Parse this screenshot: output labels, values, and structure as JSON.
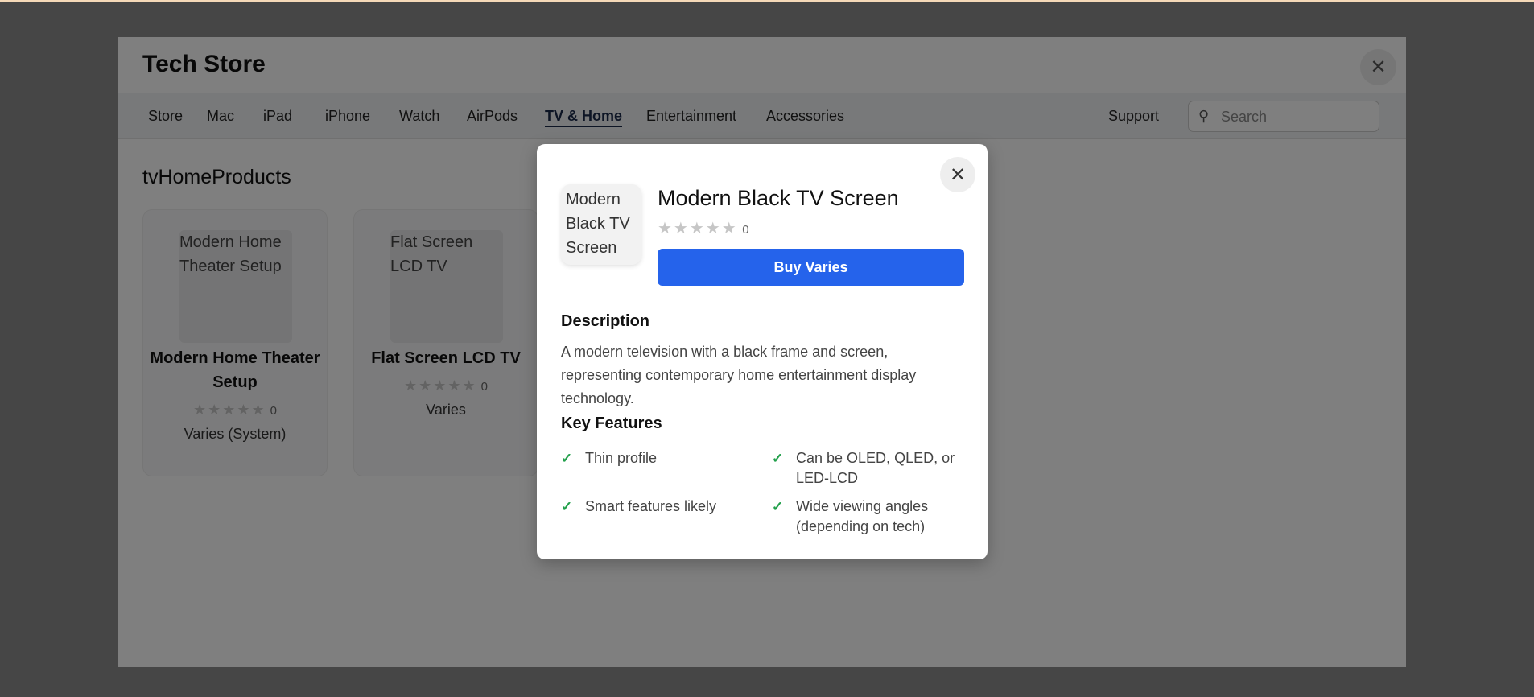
{
  "colors": {
    "accent": "#2563eb",
    "backdrop": "#464646",
    "check": "#22a04b",
    "star_empty": "#c6c6c6"
  },
  "store": {
    "brand": "Tech Store",
    "close_icon": "close-icon",
    "nav": {
      "items": [
        {
          "label": "Store"
        },
        {
          "label": "Mac"
        },
        {
          "label": "iPad"
        },
        {
          "label": "iPhone"
        },
        {
          "label": "Watch"
        },
        {
          "label": "AirPods"
        },
        {
          "label": "TV & Home",
          "active": true
        },
        {
          "label": "Entertainment"
        },
        {
          "label": "Accessories"
        }
      ],
      "support": "Support",
      "search_placeholder": "Search",
      "search_icon": "search-icon"
    },
    "section_title": "tvHomeProducts",
    "products": [
      {
        "image_alt": "Modern Home Theater Setup",
        "title": "Modern Home Theater Setup",
        "stars": "★★★★★",
        "rating_count": "0",
        "price": "Varies (System)"
      },
      {
        "image_alt": "Flat Screen LCD TV",
        "title": "Flat Screen LCD TV",
        "stars": "★★★★★",
        "rating_count": "0",
        "price": "Varies"
      }
    ]
  },
  "modal": {
    "image_alt": "Modern Black TV Screen",
    "title": "Modern Black TV Screen",
    "stars": "★★★★★",
    "rating_count": "0",
    "buy_label": "Buy Varies",
    "description_heading": "Description",
    "description": "A modern television with a black frame and screen, representing contemporary home entertainment display technology.",
    "features_heading": "Key Features",
    "features": [
      "Thin profile",
      "Can be OLED, QLED, or LED-LCD",
      "Smart features likely",
      "Wide viewing angles (depending on tech)"
    ],
    "close_icon": "close-icon",
    "check_icon": "check-icon"
  }
}
